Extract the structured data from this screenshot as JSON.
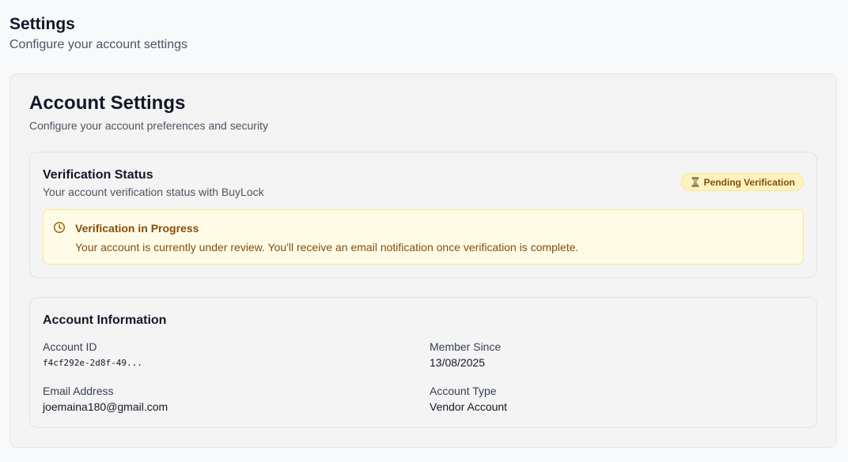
{
  "header": {
    "title": "Settings",
    "subtitle": "Configure your account settings"
  },
  "account_settings": {
    "title": "Account Settings",
    "subtitle": "Configure your account preferences and security"
  },
  "verification": {
    "title": "Verification Status",
    "subtitle": "Your account verification status with BuyLock",
    "badge": {
      "label": "Pending Verification",
      "icon": "hourglass-icon",
      "color": "#854d0e",
      "background": "#fef3c0"
    },
    "alert": {
      "icon": "clock-icon",
      "title": "Verification in Progress",
      "message": "Your account is currently under review. You'll receive an email notification once verification is complete."
    }
  },
  "account_info": {
    "title": "Account Information",
    "fields": [
      {
        "label": "Account ID",
        "value": "f4cf292e-2d8f-49..."
      },
      {
        "label": "Member Since",
        "value": "13/08/2025"
      },
      {
        "label": "Email Address",
        "value": "joemaina180@gmail.com"
      },
      {
        "label": "Account Type",
        "value": "Vendor Account"
      }
    ]
  }
}
